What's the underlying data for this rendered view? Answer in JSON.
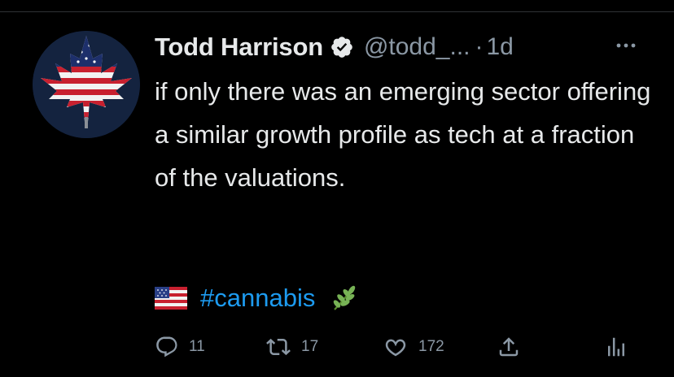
{
  "tweet": {
    "author_name": "Todd Harrison",
    "handle": "@todd_...",
    "separator": "·",
    "time": "1d",
    "text": "if only there was an emerging sector offering a similar growth profile as tech at a fraction of the valuations.",
    "hashtag": "#cannabis"
  },
  "icons": {
    "verified": "verified-badge-icon",
    "more": "more-horizontal-icon",
    "flag": "us-flag-emoji",
    "herb": "herb-emoji",
    "reply": "reply-icon",
    "retweet": "retweet-icon",
    "like": "heart-icon",
    "share": "share-icon",
    "analytics": "analytics-icon"
  },
  "actions": {
    "reply_count": "11",
    "retweet_count": "17",
    "like_count": "172"
  },
  "colors": {
    "background": "#000000",
    "text": "#e7e9ea",
    "secondary": "#8b98a5",
    "link": "#1d9bf0"
  }
}
